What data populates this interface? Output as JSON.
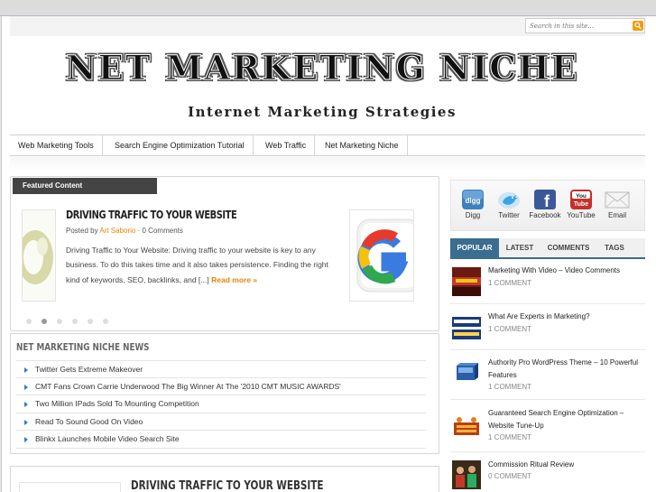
{
  "search": {
    "placeholder": "Search in this site..."
  },
  "header": {
    "logo_title": "NET MARKETING NICHE",
    "tagline": "Internet Marketing Strategies"
  },
  "nav": {
    "items": [
      {
        "label": "Web Marketing Tools"
      },
      {
        "label": "Search Engine Optimization Tutorial"
      },
      {
        "label": "Web Traffic"
      },
      {
        "label": "Net Marketing Niche"
      }
    ]
  },
  "featured": {
    "tab_label": "Featured Content",
    "title": "DRIVING TRAFFIC TO YOUR WEBSITE",
    "meta_prefix": "Posted by",
    "author": "Art Saborio",
    "comments": "· 0 Comments",
    "excerpt": "Driving Traffic to Your Website: Driving traffic to your website is key to any business. To do this takes time and it also takes persistence. Finding the right kind of keywords, SEO, backlinks, and [...]",
    "read_more": "Read more »",
    "slide_count": 6,
    "active_slide": 2
  },
  "news": {
    "title": "NET MARKETING NICHE NEWS",
    "items": [
      "Twitter Gets Extreme Makeover",
      "CMT Fans Crown Carrie Underwood The Big Winner At The '2010 CMT MUSIC AWARDS'",
      "Two Million IPads Sold To Mounting Competition",
      "Read To Sound Good On Video",
      "Blinkx Launches Mobile Video Search Site"
    ]
  },
  "post": {
    "title": "DRIVING TRAFFIC TO YOUR WEBSITE"
  },
  "social": {
    "items": [
      {
        "label": "Digg",
        "icon": "digg-icon"
      },
      {
        "label": "Twitter",
        "icon": "twitter-icon"
      },
      {
        "label": "Facebook",
        "icon": "facebook-icon"
      },
      {
        "label": "YouTube",
        "icon": "youtube-icon"
      },
      {
        "label": "Email",
        "icon": "email-icon"
      }
    ]
  },
  "tabs": {
    "items": [
      "POPULAR",
      "LATEST",
      "COMMENTS",
      "TAGS"
    ],
    "active": "POPULAR"
  },
  "popular": {
    "items": [
      {
        "title": "Marketing With Video – Video Comments",
        "comments": "1 COMMENT"
      },
      {
        "title": "What Are Experts in Marketing?",
        "comments": "1 COMMENT"
      },
      {
        "title": "Authority Pro WordPress Theme – 10 Powerful Features",
        "comments": "1 COMMENT"
      },
      {
        "title": "Guaranteed Search Engine Optimization – Website Tune-Up",
        "comments": "1 COMMENT"
      },
      {
        "title": "Commission Ritual Review",
        "comments": "0 COMMENT"
      }
    ]
  },
  "colors": {
    "accent": "#e8850a",
    "tab_active": "#3a6d8f",
    "bullet": "#2b7bd6"
  }
}
